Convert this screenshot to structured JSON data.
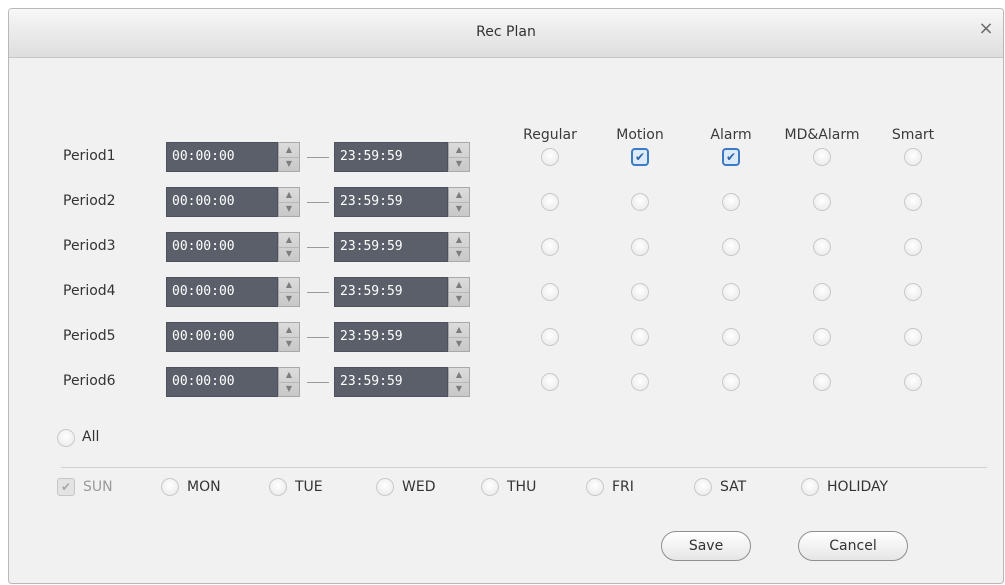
{
  "dialog": {
    "title": "Rec Plan",
    "close_glyph": "×"
  },
  "columns": [
    "Regular",
    "Motion",
    "Alarm",
    "MD&Alarm",
    "Smart"
  ],
  "periods": [
    {
      "label": "Period1",
      "start": "00:00:00",
      "end": "23:59:59",
      "checks": [
        false,
        true,
        true,
        false,
        false
      ]
    },
    {
      "label": "Period2",
      "start": "00:00:00",
      "end": "23:59:59",
      "checks": [
        false,
        false,
        false,
        false,
        false
      ]
    },
    {
      "label": "Period3",
      "start": "00:00:00",
      "end": "23:59:59",
      "checks": [
        false,
        false,
        false,
        false,
        false
      ]
    },
    {
      "label": "Period4",
      "start": "00:00:00",
      "end": "23:59:59",
      "checks": [
        false,
        false,
        false,
        false,
        false
      ]
    },
    {
      "label": "Period5",
      "start": "00:00:00",
      "end": "23:59:59",
      "checks": [
        false,
        false,
        false,
        false,
        false
      ]
    },
    {
      "label": "Period6",
      "start": "00:00:00",
      "end": "23:59:59",
      "checks": [
        false,
        false,
        false,
        false,
        false
      ]
    }
  ],
  "all_label": "All",
  "days": [
    {
      "label": "SUN",
      "checked": true,
      "disabled": true
    },
    {
      "label": "MON",
      "checked": false,
      "disabled": false
    },
    {
      "label": "TUE",
      "checked": false,
      "disabled": false
    },
    {
      "label": "WED",
      "checked": false,
      "disabled": false
    },
    {
      "label": "THU",
      "checked": false,
      "disabled": false
    },
    {
      "label": "FRI",
      "checked": false,
      "disabled": false
    },
    {
      "label": "SAT",
      "checked": false,
      "disabled": false
    },
    {
      "label": "HOLIDAY",
      "checked": false,
      "disabled": false
    }
  ],
  "buttons": {
    "save": "Save",
    "cancel": "Cancel"
  },
  "icons": {
    "spin_up": "▲",
    "spin_down": "▼",
    "check": "✔"
  },
  "colors": {
    "time_field_bg": "#5b5f6a",
    "checkbox_border": "#3e79c3"
  }
}
